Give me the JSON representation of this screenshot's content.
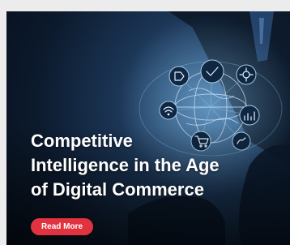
{
  "banner": {
    "title_lines": [
      "Competitive",
      "Intelligence in the Age",
      "of Digital Commerce"
    ],
    "cta_label": "Read More"
  },
  "colors": {
    "page_bg": "#ececec",
    "card_dark": "#0c1a2d",
    "glow": "#6fb0e8",
    "button": "#e0323f",
    "text": "#ffffff"
  },
  "icons": [
    "gear-icon",
    "globe-icon",
    "shopping-cart-icon",
    "wifi-icon",
    "checkmark-icon",
    "chart-icon",
    "hand-icon"
  ]
}
